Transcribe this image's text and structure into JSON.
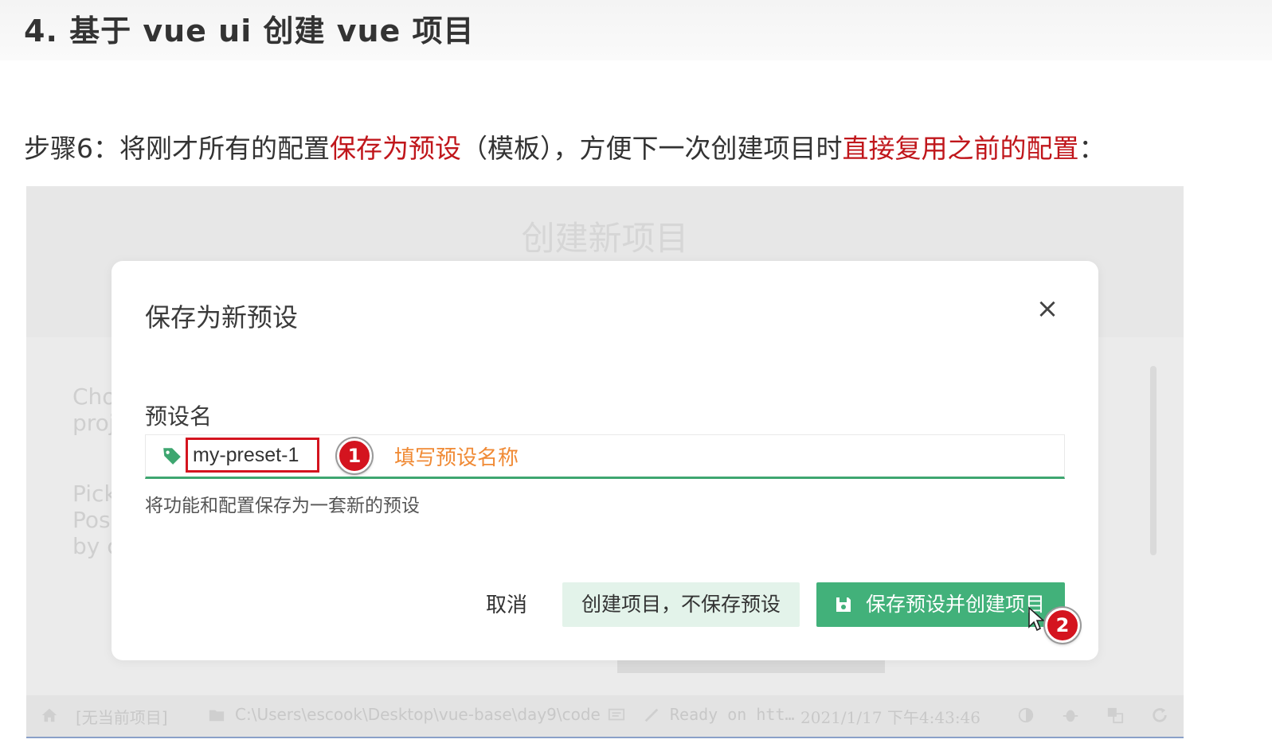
{
  "heading": "4. 基于 vue ui 创建 vue 项目",
  "step": {
    "prefix": "步骤6：将刚才所有的配置",
    "highlight1": "保存为预设",
    "middle": "（模板），方便下一次创建项目时",
    "highlight2": "直接复用之前的配置",
    "suffix": "："
  },
  "background_screen": {
    "title": "创建新项目",
    "faded_text_1": [
      "Cho",
      "proj"
    ],
    "faded_text_2": [
      "Pick",
      "Pos",
      "by c"
    ]
  },
  "statusbar": {
    "home_label": "[无当前项目]",
    "path": "C:\\Users\\escook\\Desktop\\vue-base\\day9\\code",
    "log": "Ready on htt…",
    "timestamp": "2021/1/17 下午4:43:46"
  },
  "dialog": {
    "title": "保存为新预设",
    "close_glyph": "×",
    "field_label": "预设名",
    "field_value": "my-preset-1",
    "annotation_1_number": "1",
    "annotation_1_text": "填写预设名称",
    "helper_text": "将功能和配置保存为一套新的预设",
    "buttons": {
      "cancel": "取消",
      "create_without_saving": "创建项目，不保存预设",
      "save_and_create": "保存预设并创建项目"
    },
    "annotation_2_number": "2"
  },
  "colors": {
    "accent_green": "#42b17a",
    "annotation_red": "#d4141f",
    "annotation_orange": "#f08a35",
    "highlight_red": "#c0161b"
  }
}
